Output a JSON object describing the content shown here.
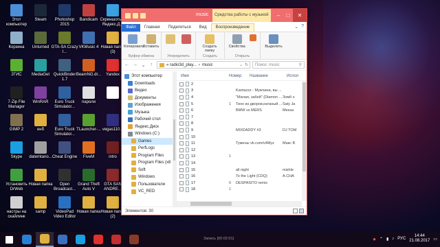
{
  "desktop_icons": [
    {
      "label": "Этот компьютер",
      "color": "#4a8fd8",
      "x": 0,
      "y": 0
    },
    {
      "label": "Steam",
      "color": "#1b2838",
      "x": 1,
      "y": 0
    },
    {
      "label": "Photoshop 2015",
      "color": "#1f3a6a",
      "x": 2,
      "y": 0
    },
    {
      "label": "Bandicam",
      "color": "#c04040",
      "x": 3,
      "y": 0
    },
    {
      "label": "Скриншоты в Яндекс.Д...",
      "color": "#3aa0e0",
      "x": 4,
      "y": 0
    },
    {
      "label": "Корзина",
      "color": "#8fb0c8",
      "x": 0,
      "y": 1
    },
    {
      "label": "Unturned",
      "color": "#5a6a3a",
      "x": 1,
      "y": 1
    },
    {
      "label": "GTA-SA Crazy I...",
      "color": "#6a7a2a",
      "x": 2,
      "y": 1
    },
    {
      "label": "VKMusic 4",
      "color": "#4070b0",
      "x": 3,
      "y": 1
    },
    {
      "label": "Новая папка (3)",
      "color": "#e0b040",
      "x": 4,
      "y": 1
    },
    {
      "label": "2ГИС",
      "color": "#5ab030",
      "x": 0,
      "y": 2
    },
    {
      "label": "MediaGet",
      "color": "#2aa0a0",
      "x": 1,
      "y": 2
    },
    {
      "label": "QuickBinder 1.7",
      "color": "#406080",
      "x": 2,
      "y": 2
    },
    {
      "label": "BeamNG.dr...",
      "color": "#d06020",
      "x": 3,
      "y": 2
    },
    {
      "label": "Yandex",
      "color": "#e03030",
      "x": 4,
      "y": 2
    },
    {
      "label": "7-Zip File Manager",
      "color": "#202020",
      "x": 0,
      "y": 3
    },
    {
      "label": "WinRAR",
      "color": "#8040a0",
      "x": 1,
      "y": 3
    },
    {
      "label": "Euro Truck Simulator...",
      "color": "#3060a0",
      "x": 2,
      "y": 3
    },
    {
      "label": "пароли",
      "color": "#e0e0e0",
      "x": 3,
      "y": 3
    },
    {
      "label": "",
      "color": "#ffffff",
      "x": 4,
      "y": 3
    },
    {
      "label": "GIMP 2",
      "color": "#807050",
      "x": 0,
      "y": 4
    },
    {
      "label": "енб",
      "color": "#e0b040",
      "x": 1,
      "y": 4
    },
    {
      "label": "Euro Truck Simulator...",
      "color": "#3060a0",
      "x": 2,
      "y": 4
    },
    {
      "label": "TLauncher-...",
      "color": "#5aa030",
      "x": 3,
      "y": 4
    },
    {
      "label": "vegas110...",
      "color": "#303080",
      "x": 4,
      "y": 4
    },
    {
      "label": "Skype",
      "color": "#1a9fe0",
      "x": 0,
      "y": 5
    },
    {
      "label": "datemtano...",
      "color": "#a0a0a0",
      "x": 1,
      "y": 5
    },
    {
      "label": "Cheat Engine",
      "color": "#405080",
      "x": 2,
      "y": 5
    },
    {
      "label": "FiveM",
      "color": "#e07020",
      "x": 3,
      "y": 5
    },
    {
      "label": "intro",
      "color": "#702020",
      "x": 4,
      "y": 5
    },
    {
      "label": "Установить DrWeb",
      "color": "#40a040",
      "x": 0,
      "y": 6
    },
    {
      "label": "Новая папка",
      "color": "#e0b040",
      "x": 1,
      "y": 6
    },
    {
      "label": "Open Broadcast...",
      "color": "#303030",
      "x": 2,
      "y": 6
    },
    {
      "label": "Grand Theft Auto V",
      "color": "#2a6a2a",
      "x": 3,
      "y": 6
    },
    {
      "label": "GTA SAN ANDRE...",
      "color": "#8a2a2a",
      "x": 4,
      "y": 6
    },
    {
      "label": "настры на скайлинк",
      "color": "#d0d0d0",
      "x": 0,
      "y": 7
    },
    {
      "label": "samp",
      "color": "#e0b040",
      "x": 1,
      "y": 7
    },
    {
      "label": "VideoPad Video Editor",
      "color": "#2a70c0",
      "x": 2,
      "y": 7
    },
    {
      "label": "Новая папка",
      "color": "#e0b040",
      "x": 3,
      "y": 7
    },
    {
      "label": "Новая папка (2)",
      "color": "#e0b040",
      "x": 4,
      "y": 7
    }
  ],
  "explorer": {
    "title": "music",
    "context_tab": "Средства работы с музыкой",
    "ribbon_tabs": [
      "Файл",
      "Главная",
      "Поделиться",
      "Вид",
      "Воспроизведение"
    ],
    "ribbon_groups": [
      {
        "name": "Буфер обмена",
        "buttons": [
          "Копировать",
          "Вставить"
        ]
      },
      {
        "name": "Упорядочить",
        "buttons": [
          "",
          ""
        ]
      },
      {
        "name": "Создать",
        "buttons": [
          "Создать папку"
        ]
      },
      {
        "name": "Открыть",
        "buttons": [
          "Свойства"
        ]
      },
      {
        "name": "",
        "buttons": [
          "Выделить"
        ]
      }
    ],
    "address": {
      "crumbs": [
        "« radio3d_play...",
        "music"
      ],
      "search_placeholder": "Поиск: music"
    },
    "nav_pane": [
      {
        "label": "Этот компьютер",
        "color": "#4a8fd8",
        "indent": 0
      },
      {
        "label": "Downloads",
        "color": "#3a80d0",
        "indent": 1
      },
      {
        "label": "Видео",
        "color": "#5a6ad0",
        "indent": 1
      },
      {
        "label": "Документы",
        "color": "#d0c070",
        "indent": 1
      },
      {
        "label": "Изображения",
        "color": "#60a0d0",
        "indent": 1
      },
      {
        "label": "Музыка",
        "color": "#4aa0d0",
        "indent": 1
      },
      {
        "label": "Рабочий стол",
        "color": "#3a70c0",
        "indent": 1
      },
      {
        "label": "Яндекс.Диск",
        "color": "#e0a040",
        "indent": 1
      },
      {
        "label": "Windows (C:)",
        "color": "#808890",
        "indent": 1
      },
      {
        "label": "Games",
        "color": "#e0b040",
        "indent": 2,
        "selected": true
      },
      {
        "label": "PerfLogs",
        "color": "#e0b040",
        "indent": 2
      },
      {
        "label": "Program Files",
        "color": "#e0b040",
        "indent": 2
      },
      {
        "label": "Program Files (x8",
        "color": "#e0b040",
        "indent": 2
      },
      {
        "label": "Soft",
        "color": "#e0b040",
        "indent": 2
      },
      {
        "label": "Windows",
        "color": "#e0b040",
        "indent": 2
      },
      {
        "label": "Пользователи",
        "color": "#e0b040",
        "indent": 2
      },
      {
        "label": "VC_RED",
        "color": "#e0b040",
        "indent": 2
      }
    ],
    "columns": [
      "Имя",
      "Номер",
      "Название",
      "Испол"
    ],
    "files": [
      {
        "name": "2",
        "num": "",
        "title": "",
        "artist": ""
      },
      {
        "name": "3",
        "num": "",
        "title": "Kamazzz - Мужчина, вы ...",
        "artist": ""
      },
      {
        "name": "4",
        "num": "",
        "title": "\"Малая, забей\" (Diamon ...",
        "artist": "Зомб х"
      },
      {
        "name": "5",
        "num": "1",
        "title": "Тихо из дворов,катаный ...",
        "artist": "Saty Ja"
      },
      {
        "name": "6",
        "num": "",
        "title": "BMW vs MERS",
        "artist": "Messa"
      },
      {
        "name": "7",
        "num": "",
        "title": "",
        "artist": ""
      },
      {
        "name": "8",
        "num": "",
        "title": "",
        "artist": ""
      },
      {
        "name": "9",
        "num": "",
        "title": "MIXDADDY #3",
        "artist": "DJ TOM"
      },
      {
        "name": "10",
        "num": "",
        "title": "",
        "artist": ""
      },
      {
        "name": "11",
        "num": "",
        "title": "Тумены vk.com/v4Myz",
        "artist": "Макс В"
      },
      {
        "name": "12",
        "num": "",
        "title": "",
        "artist": ""
      },
      {
        "name": "13",
        "num": "1",
        "title": "",
        "artist": ""
      },
      {
        "name": "14",
        "num": "",
        "title": "",
        "artist": ""
      },
      {
        "name": "15",
        "num": "",
        "title": "all night",
        "artist": "mishle"
      },
      {
        "name": "16",
        "num": "",
        "title": "To the Light (CDQ)",
        "artist": "A.CHA"
      },
      {
        "name": "17",
        "num": "0",
        "title": "DESPASITO remix",
        "artist": ""
      },
      {
        "name": "18",
        "num": "1",
        "title": "",
        "artist": ""
      }
    ],
    "status": "Элементов: 30"
  },
  "taskbar": {
    "recording_label": "Запись [00:02:01]",
    "items": [
      {
        "name": "start",
        "color": "#ffffff"
      },
      {
        "name": "ie",
        "color": "#2a80d0"
      },
      {
        "name": "explorer",
        "color": "#e0b040",
        "active": true
      },
      {
        "name": "store",
        "color": "#3a70c0"
      },
      {
        "name": "skype",
        "color": "#1a9fe0"
      },
      {
        "name": "yandex",
        "color": "#e03030"
      },
      {
        "name": "bandicam",
        "color": "#c03030"
      },
      {
        "name": "gta",
        "color": "#8a3a2a"
      }
    ],
    "language": "РУС",
    "time": "14:44",
    "date": "21.08.2017"
  }
}
